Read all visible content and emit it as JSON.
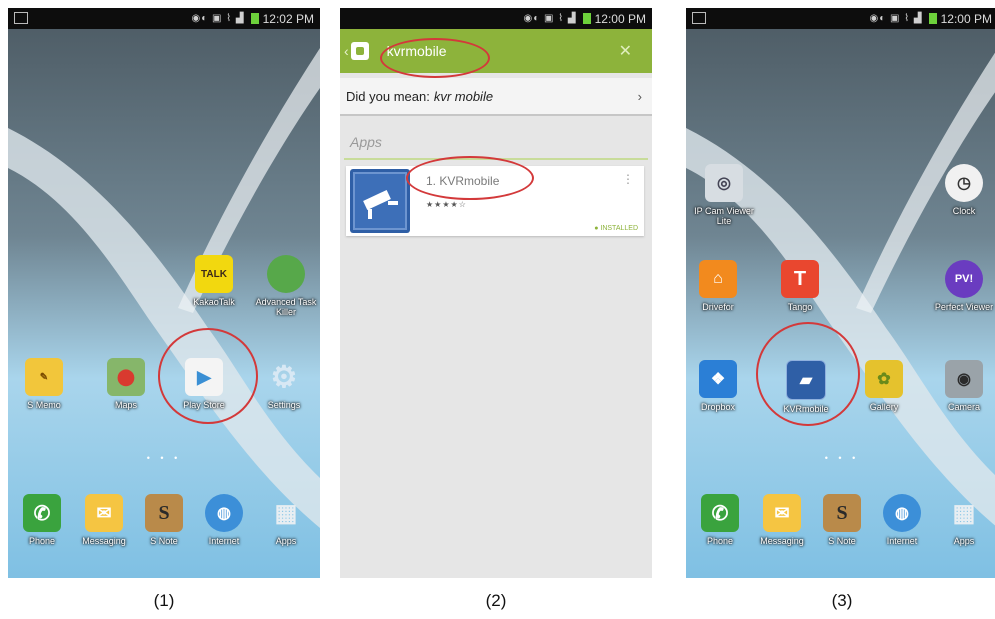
{
  "status_bar": {
    "time_1": "12:02 PM",
    "time_2": "12:00 PM",
    "time_3": "12:00 PM"
  },
  "panel1": {
    "apps_row1": [
      {
        "label": "KakaoTalk",
        "icon": "kakaotalk-icon"
      },
      {
        "label": "Advanced Task Killer",
        "icon": "task-killer-icon"
      }
    ],
    "apps_row2": [
      {
        "label": "S Memo",
        "icon": "smemo-icon"
      },
      {
        "label": "Maps",
        "icon": "maps-icon"
      },
      {
        "label": "Play Store",
        "icon": "play-store-icon"
      },
      {
        "label": "Settings",
        "icon": "gear-icon"
      }
    ],
    "dock": [
      {
        "label": "Phone",
        "icon": "phone-icon"
      },
      {
        "label": "Messaging",
        "icon": "messaging-icon"
      },
      {
        "label": "S Note",
        "icon": "snote-icon"
      },
      {
        "label": "Internet",
        "icon": "internet-icon"
      },
      {
        "label": "Apps",
        "icon": "apps-grid-icon"
      }
    ]
  },
  "panel2": {
    "search_query": "kvrmobile",
    "did_you_mean_prefix": "Did you mean:",
    "did_you_mean_term": "kvr mobile",
    "section_title": "Apps",
    "result": {
      "name": "1. KVRmobile",
      "stars": "★★★★☆",
      "status": "INSTALLED"
    }
  },
  "panel3": {
    "apps_row0": [
      {
        "label": "IP Cam Viewer Lite",
        "icon": "ipcam-icon"
      },
      {
        "label": "Clock",
        "icon": "clock-icon"
      }
    ],
    "apps_row1": [
      {
        "label": "Drivefor",
        "icon": "drivefor-icon"
      },
      {
        "label": "Tango",
        "icon": "tango-icon"
      },
      {
        "label": "Perfect Viewer",
        "icon": "perfect-viewer-icon"
      }
    ],
    "apps_row2": [
      {
        "label": "Dropbox",
        "icon": "dropbox-icon"
      },
      {
        "label": "KVRmobile",
        "icon": "kvrmobile-icon"
      },
      {
        "label": "Gallery",
        "icon": "gallery-icon"
      },
      {
        "label": "Camera",
        "icon": "camera-icon"
      }
    ],
    "dock": [
      {
        "label": "Phone",
        "icon": "phone-icon"
      },
      {
        "label": "Messaging",
        "icon": "messaging-icon"
      },
      {
        "label": "S Note",
        "icon": "snote-icon"
      },
      {
        "label": "Internet",
        "icon": "internet-icon"
      },
      {
        "label": "Apps",
        "icon": "apps-grid-icon"
      }
    ]
  },
  "captions": [
    "(1)",
    "(2)",
    "(3)"
  ],
  "colors": {
    "highlight_circle": "#d3393a",
    "play_green": "#8db33b",
    "kvr_blue": "#2f5fa6"
  }
}
